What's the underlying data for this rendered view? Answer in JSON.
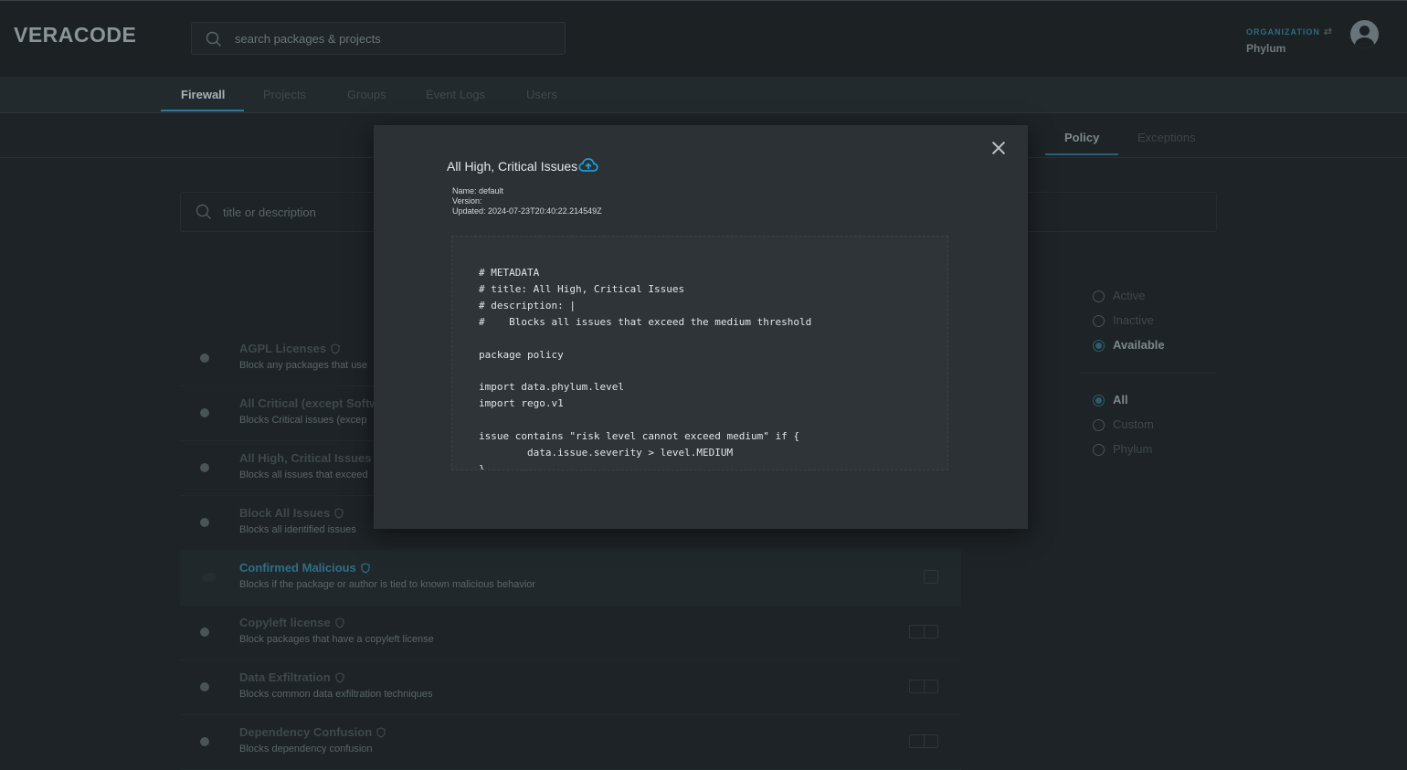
{
  "header": {
    "logo": "VERACODE",
    "search_placeholder": "search packages & projects",
    "org_label": "ORGANIZATION",
    "org_name": "Phylum"
  },
  "nav": {
    "tabs": [
      {
        "label": "Firewall",
        "active": true
      },
      {
        "label": "Projects"
      },
      {
        "label": "Groups"
      },
      {
        "label": "Event Logs"
      },
      {
        "label": "Users"
      }
    ]
  },
  "subnav": {
    "tabs": [
      {
        "label": "Policy",
        "active": true
      },
      {
        "label": "Exceptions"
      }
    ]
  },
  "policy_search": {
    "placeholder": "title or description"
  },
  "policies": [
    {
      "title": "AGPL Licenses",
      "desc": "Block any packages that use"
    },
    {
      "title": "All Critical (except Softw",
      "desc": "Blocks Critical issues (excep"
    },
    {
      "title": "All High, Critical Issues",
      "desc": "Blocks all issues that exceed"
    },
    {
      "title": "Block All Issues",
      "desc": "Blocks all identified issues"
    },
    {
      "title": "Confirmed Malicious",
      "desc": "Blocks if the package or author is tied to known malicious behavior"
    },
    {
      "title": "Copyleft license",
      "desc": "Block packages that have a copyleft license"
    },
    {
      "title": "Data Exfiltration",
      "desc": "Blocks common data exfiltration techniques"
    },
    {
      "title": "Dependency Confusion",
      "desc": "Blocks dependency confusion"
    }
  ],
  "filters": {
    "status": [
      {
        "label": "Active",
        "selected": false
      },
      {
        "label": "Inactive",
        "selected": false
      },
      {
        "label": "Available",
        "selected": true
      }
    ],
    "source": [
      {
        "label": "All",
        "selected": true
      },
      {
        "label": "Custom",
        "selected": false
      },
      {
        "label": "Phylum",
        "selected": false
      }
    ]
  },
  "modal": {
    "title": "All High, Critical Issues",
    "meta_name": "Name: default",
    "meta_version": "Version:",
    "meta_updated": "Updated: 2024-07-23T20:40:22.214549Z",
    "code": "# METADATA\n# title: All High, Critical Issues\n# description: |\n#    Blocks all issues that exceed the medium threshold\n\npackage policy\n\nimport data.phylum.level\nimport rego.v1\n\nissue contains \"risk level cannot exceed medium\" if {\n        data.issue.severity > level.MEDIUM\n}"
  },
  "colors": {
    "accent": "#1e9ed3",
    "background": "#1d2326",
    "modal": "#2b3134"
  }
}
